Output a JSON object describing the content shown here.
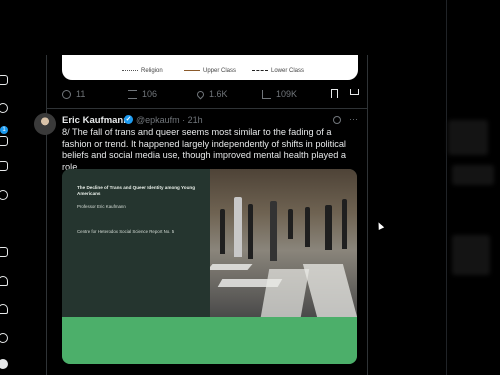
{
  "legend": {
    "items": [
      {
        "label": "Religion",
        "color": "#555555",
        "style": "dotted"
      },
      {
        "label": "Upper Class",
        "color": "#8b5a2b",
        "style": "solid"
      },
      {
        "label": "Lower Class",
        "color": "#222222",
        "style": "dashed"
      }
    ]
  },
  "previous_tweet_actions": {
    "replies": "11",
    "reposts": "106",
    "likes": "1.6K",
    "views": "109K"
  },
  "tweet": {
    "author_name": "Eric Kaufmann",
    "verified_mark": "✓",
    "handle_time": "@epkaufm · 21h",
    "more": "···",
    "text": "8/ The fall of trans and queer seems most similar to the fading of a fashion or trend. It happened largely independently of shifts in political beliefs and social media use, though improved mental health played a role.",
    "media": {
      "title": "The Decline of Trans and Queer Identity among Young Americans",
      "author": "Professor Eric Kaufmann",
      "org": "Centre for Heterodox Social Science Report No. 5"
    }
  },
  "nav": {
    "badge_1": "1"
  },
  "colors": {
    "accent": "#1d9bf0",
    "background": "#000000",
    "cover_green": "#25352f",
    "cover_bottom": "#4caf6a"
  }
}
